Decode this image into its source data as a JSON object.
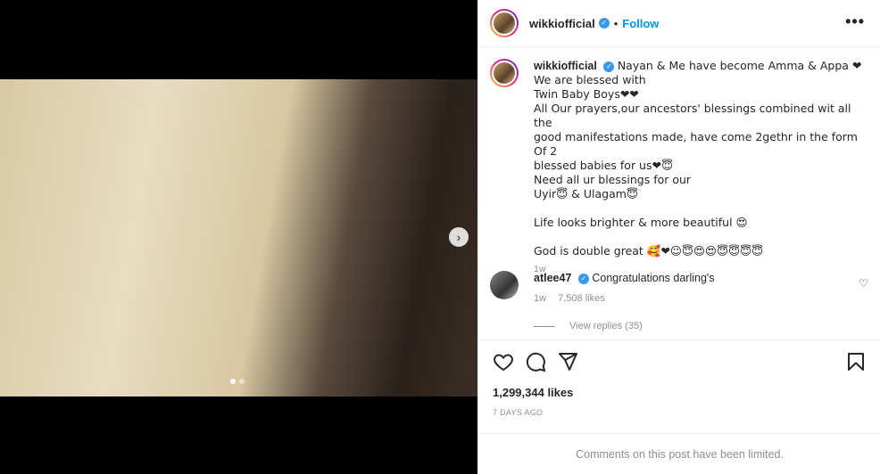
{
  "post": {
    "author": "wikkiofficial",
    "follow_label": "Follow",
    "separator": "•",
    "more_icon": "•••",
    "caption_lines": [
      "Nayan & Me have become Amma & Appa ❤",
      "We are blessed with",
      "Twin Baby Boys❤❤",
      "All Our prayers,our ancestors' blessings combined wit all the",
      "good manifestations made, have come 2gethr in the form Of 2",
      "blessed babies for us❤😇",
      "Need all ur blessings for our",
      "Uyir😇 & Ulagam😇",
      "",
      "Life looks brighter & more beautiful 😍",
      "",
      "God is double great 🥰❤☺😇😍😍😇😇😇😇"
    ],
    "caption_age": "1w",
    "likes": "1,299,344 likes",
    "date": "7 DAYS AGO",
    "comments_limited": "Comments on this post have been limited."
  },
  "comment": {
    "author": "atlee47",
    "text": "Congratulations darling's",
    "age": "1w",
    "likes": "7,508 likes",
    "view_replies": "View replies (35)"
  },
  "icons": {
    "next": "›",
    "heart_small": "♡"
  }
}
